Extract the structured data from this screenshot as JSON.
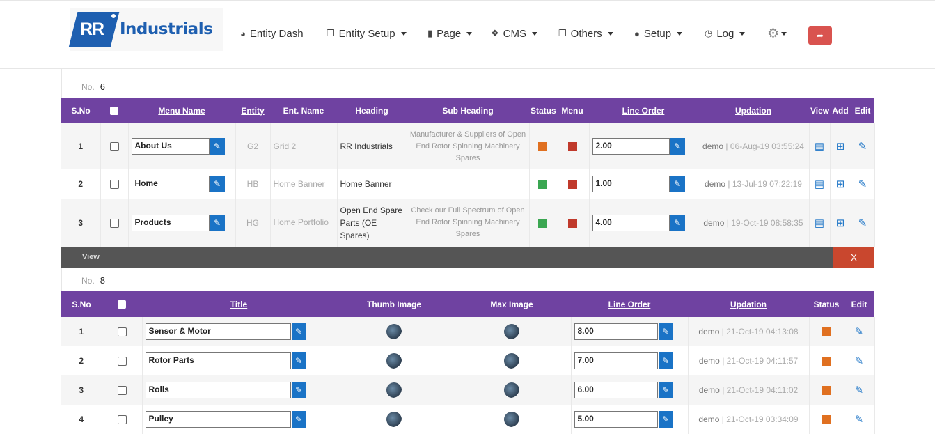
{
  "brand": {
    "prefix": "RR",
    "name": "Industrials"
  },
  "nav": [
    {
      "label": "Entity Dash",
      "icon": "pie-chart-icon",
      "dropdown": false
    },
    {
      "label": "Entity Setup",
      "icon": "copy-icon",
      "dropdown": true
    },
    {
      "label": "Page",
      "icon": "file-icon",
      "dropdown": true
    },
    {
      "label": "CMS",
      "icon": "cubes-icon",
      "dropdown": true
    },
    {
      "label": "Others",
      "icon": "copy-icon",
      "dropdown": true
    },
    {
      "label": "Setup",
      "icon": "user-icon",
      "dropdown": true
    },
    {
      "label": "Log",
      "icon": "clock-icon",
      "dropdown": true
    }
  ],
  "table1": {
    "count_label": "No.",
    "count": "6",
    "headers": [
      "S.No",
      "Menu Name",
      "Entity",
      "Ent. Name",
      "Heading",
      "Sub Heading",
      "Status",
      "Menu",
      "Line Order",
      "Updation",
      "View",
      "Add",
      "Edit"
    ],
    "rows": [
      {
        "sno": "1",
        "menu_name": "About Us",
        "entity": "G2",
        "ent_name": "Grid 2",
        "heading": "RR Industrials",
        "sub_heading": "Manufacturer & Suppliers of Open End Rotor Spinning Machinery Spares",
        "status_color": "#e07020",
        "menu_color": "#c0392b",
        "line_order": "2.00",
        "user": "demo",
        "date": "| 06-Aug-19 03:55:24"
      },
      {
        "sno": "2",
        "menu_name": "Home",
        "entity": "HB",
        "ent_name": "Home Banner",
        "heading": "Home Banner",
        "sub_heading": "",
        "status_color": "#3aa651",
        "menu_color": "#c0392b",
        "line_order": "1.00",
        "user": "demo",
        "date": "| 13-Jul-19 07:22:19"
      },
      {
        "sno": "3",
        "menu_name": "Products",
        "entity": "HG",
        "ent_name": "Home Portfolio",
        "heading": "Open End Spare Parts (OE Spares)",
        "sub_heading": "Check our Full Spectrum of Open End Rotor Spinning Machinery Spares",
        "status_color": "#3aa651",
        "menu_color": "#c0392b",
        "line_order": "4.00",
        "user": "demo",
        "date": "| 19-Oct-19 08:58:35"
      }
    ]
  },
  "view_bar": {
    "label": "View",
    "close": "X"
  },
  "table2": {
    "count_label": "No.",
    "count": "8",
    "headers": [
      "S.No",
      "Title",
      "Thumb Image",
      "Max Image",
      "Line Order",
      "Updation",
      "Status",
      "Edit"
    ],
    "rows": [
      {
        "sno": "1",
        "title": "Sensor & Motor",
        "line_order": "8.00",
        "user": "demo",
        "date": "| 21-Oct-19 04:13:08",
        "status_color": "#e07020"
      },
      {
        "sno": "2",
        "title": "Rotor Parts",
        "line_order": "7.00",
        "user": "demo",
        "date": "| 21-Oct-19 04:11:57",
        "status_color": "#e07020"
      },
      {
        "sno": "3",
        "title": "Rolls",
        "line_order": "6.00",
        "user": "demo",
        "date": "| 21-Oct-19 04:11:02",
        "status_color": "#e07020"
      },
      {
        "sno": "4",
        "title": "Pulley",
        "line_order": "5.00",
        "user": "demo",
        "date": "| 21-Oct-19 03:34:09",
        "status_color": "#e07020"
      }
    ]
  }
}
